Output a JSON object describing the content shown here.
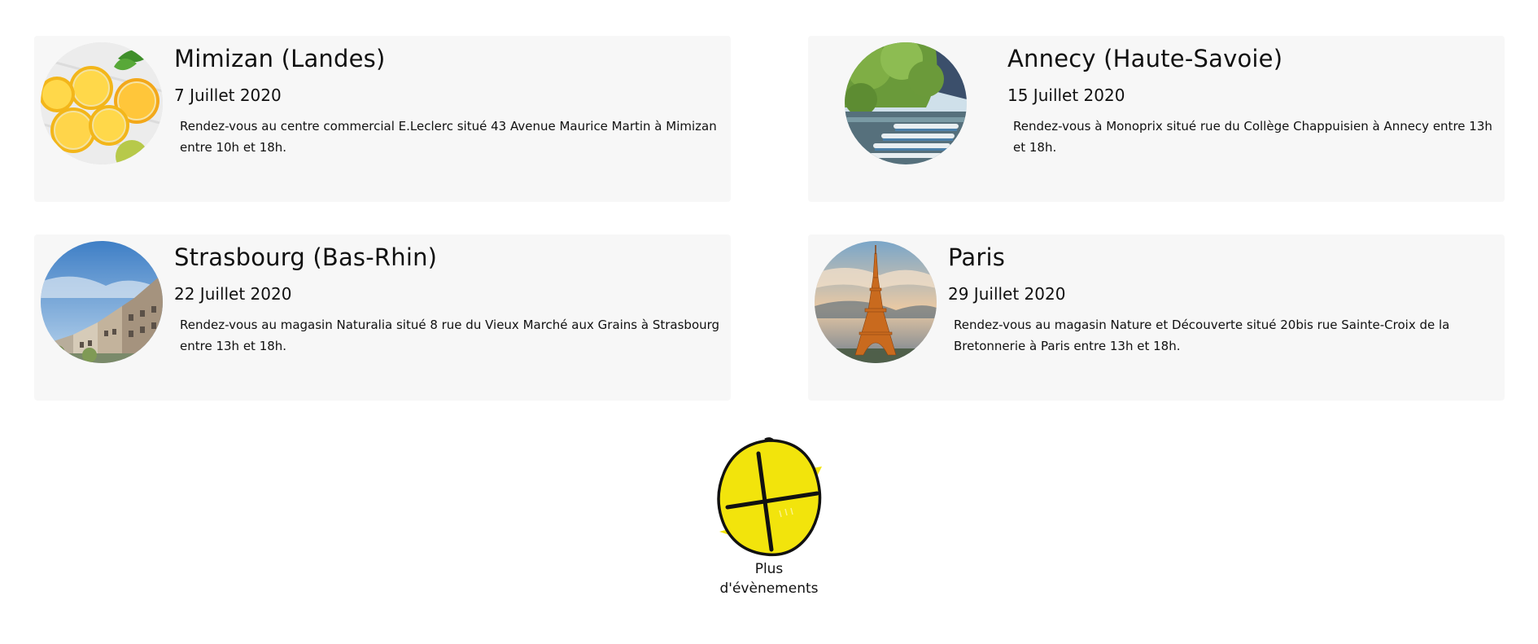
{
  "events": [
    {
      "title": "Mimizan (Landes)",
      "date": "7 Juillet 2020",
      "description": "Rendez-vous au centre commercial E.Leclerc situé 43 Avenue Maurice Martin à Mimizan entre 10h et 18h.",
      "image_icon": "lemon-slices-icon"
    },
    {
      "title": "Annecy (Haute-Savoie)",
      "date": "15 Juillet 2020",
      "description": "Rendez-vous à Monoprix situé rue du Collège Chappuisien à Annecy entre 13h et 18h.",
      "image_icon": "lake-boats-icon"
    },
    {
      "title": "Strasbourg (Bas-Rhin)",
      "date": "22 Juillet 2020",
      "description": "Rendez-vous au magasin Naturalia situé 8 rue du Vieux Marché aux Grains à Strasbourg entre 13h et 18h.",
      "image_icon": "city-riverside-icon"
    },
    {
      "title": "Paris",
      "date": "29 Juillet 2020",
      "description": "Rendez-vous au magasin Nature et Découverte situé 20bis rue Sainte-Croix de la Bretonnerie à Paris entre 13h et 18h.",
      "image_icon": "eiffel-tower-icon"
    }
  ],
  "more": {
    "label": "Plus d'évènements",
    "icon": "lemon-plus-icon",
    "color": "#f2e40c"
  }
}
